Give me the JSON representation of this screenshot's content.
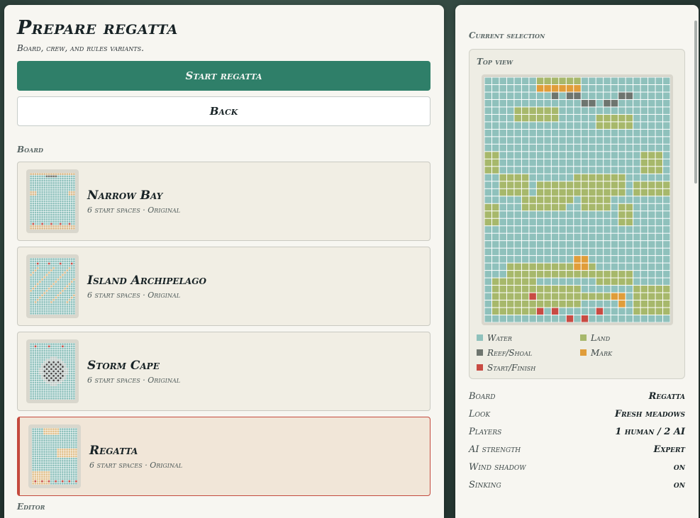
{
  "header": {
    "title": "Prepare regatta",
    "subtitle": "Board, crew, and rules variants."
  },
  "actions": {
    "start_label": "Start regatta",
    "back_label": "Back"
  },
  "board_section": {
    "label": "Board",
    "boards": [
      {
        "name": "Narrow Bay",
        "meta": "6 start spaces · Original",
        "selected": false
      },
      {
        "name": "Island Archipelago",
        "meta": "6 start spaces · Original",
        "selected": false
      },
      {
        "name": "Storm Cape",
        "meta": "6 start spaces · Original",
        "selected": false
      },
      {
        "name": "Regatta",
        "meta": "6 start spaces · Original",
        "selected": true
      }
    ]
  },
  "editor_section": {
    "label": "Editor"
  },
  "selection": {
    "label": "Current selection",
    "preview_label": "Top view",
    "legend": [
      {
        "label": "Water",
        "color": "#8fc1bc"
      },
      {
        "label": "Land",
        "color": "#a7b86b"
      },
      {
        "label": "Reef/Shoal",
        "color": "#6e756f"
      },
      {
        "label": "Mark",
        "color": "#e09d3a"
      },
      {
        "label": "Start/Finish",
        "color": "#c84b43"
      }
    ],
    "details": [
      {
        "key": "Board",
        "value": "Regatta"
      },
      {
        "key": "Look",
        "value": "Fresh meadows"
      },
      {
        "key": "Players",
        "value": "1 human / 2 AI"
      },
      {
        "key": "AI strength",
        "value": "Expert"
      },
      {
        "key": "Wind shadow",
        "value": "on"
      },
      {
        "key": "Sinking",
        "value": "on"
      }
    ]
  },
  "colors": {
    "accent": "#2f7f69",
    "selected_border": "#c44a3e",
    "water": "#8fc1bc",
    "land": "#a7b86b",
    "reef": "#6e756f",
    "mark": "#e09d3a",
    "start": "#c84b43"
  }
}
